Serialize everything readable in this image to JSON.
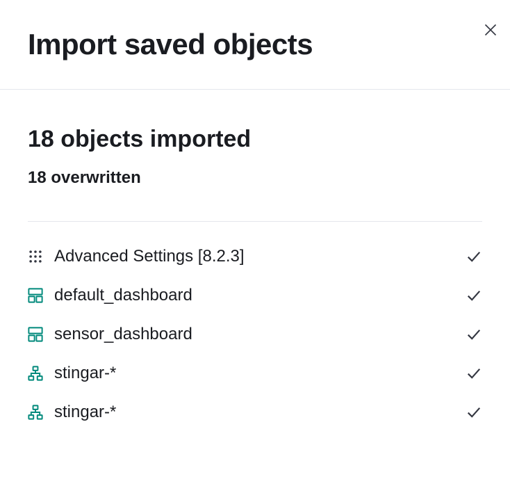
{
  "header": {
    "title": "Import saved objects"
  },
  "summary": {
    "imported_text": "18 objects imported",
    "overwritten_text": "18 overwritten"
  },
  "objects": [
    {
      "icon": "advanced-settings",
      "label": "Advanced Settings [8.2.3]",
      "status": "success"
    },
    {
      "icon": "dashboard",
      "label": "default_dashboard",
      "status": "success"
    },
    {
      "icon": "dashboard",
      "label": "sensor_dashboard",
      "status": "success"
    },
    {
      "icon": "index-pattern",
      "label": "stingar-*",
      "status": "success"
    },
    {
      "icon": "index-pattern",
      "label": "stingar-*",
      "status": "success"
    }
  ]
}
